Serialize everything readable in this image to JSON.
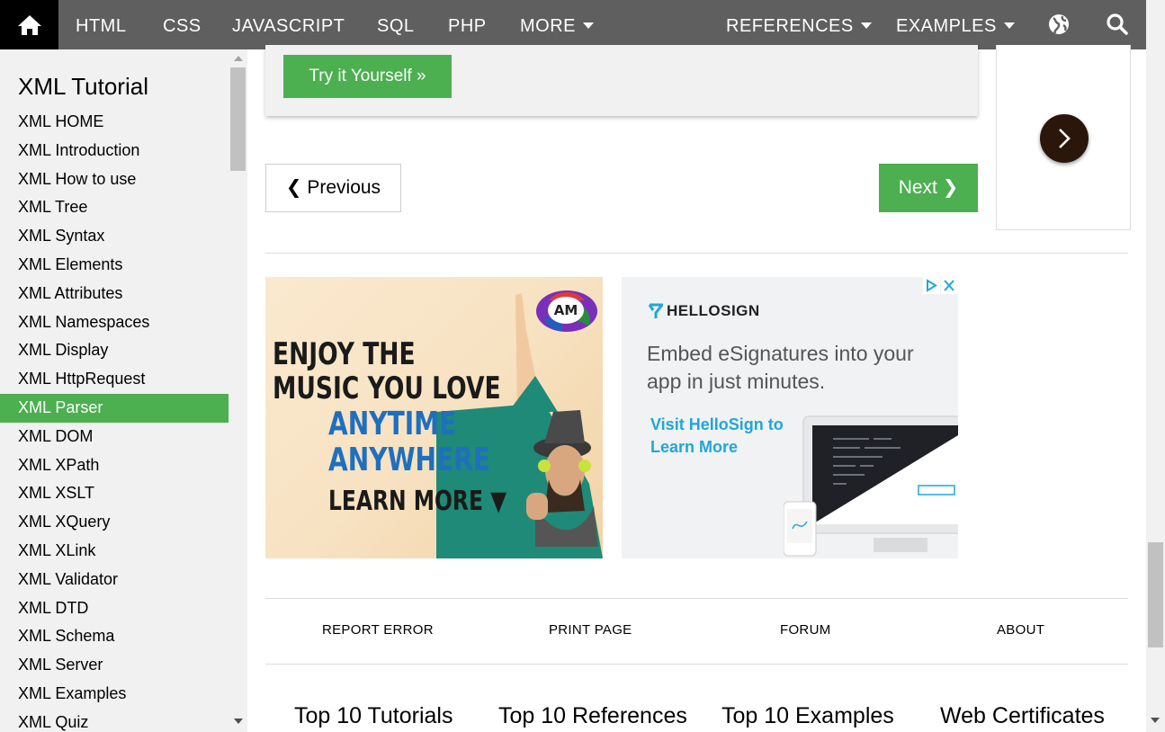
{
  "topnav": {
    "items": [
      {
        "label": "HTML"
      },
      {
        "label": "CSS"
      },
      {
        "label": "JAVASCRIPT"
      },
      {
        "label": "SQL"
      },
      {
        "label": "PHP"
      },
      {
        "label": "MORE"
      },
      {
        "label": "REFERENCES"
      },
      {
        "label": "EXAMPLES"
      }
    ],
    "home_icon": "home-icon",
    "globe_icon": "globe-icon",
    "search_icon": "search-icon"
  },
  "sidebar": {
    "title": "XML Tutorial",
    "items": [
      "XML HOME",
      "XML Introduction",
      "XML How to use",
      "XML Tree",
      "XML Syntax",
      "XML Elements",
      "XML Attributes",
      "XML Namespaces",
      "XML Display",
      "XML HttpRequest",
      "XML Parser",
      "XML DOM",
      "XML XPath",
      "XML XSLT",
      "XML XQuery",
      "XML XLink",
      "XML Validator",
      "XML DTD",
      "XML Schema",
      "XML Server",
      "XML Examples",
      "XML Quiz"
    ],
    "active_index": 10
  },
  "main": {
    "try_button": "Try it Yourself »",
    "prev_button": "❮ Previous",
    "next_button": "Next ❯"
  },
  "ad1": {
    "line1": "ENJOY THE",
    "line2": "MUSIC YOU LOVE",
    "line3": "ANYTIME",
    "line4": "ANYWHERE",
    "line5": "LEARN MORE ▼",
    "logo_text": "AM"
  },
  "ad2": {
    "brand": "HELLOSIGN",
    "headline": "Embed eSignatures into your app in just minutes.",
    "cta": "Visit HelloSign to Learn More"
  },
  "footer": {
    "links": [
      "REPORT ERROR",
      "PRINT PAGE",
      "FORUM",
      "ABOUT"
    ],
    "top10": [
      "Top 10 Tutorials",
      "Top 10 References",
      "Top 10 Examples",
      "Web Certificates"
    ]
  },
  "colors": {
    "nav_bg": "#5f5f5f",
    "accent_green": "#4caf50",
    "sidebar_bg": "#f1f1f1"
  }
}
